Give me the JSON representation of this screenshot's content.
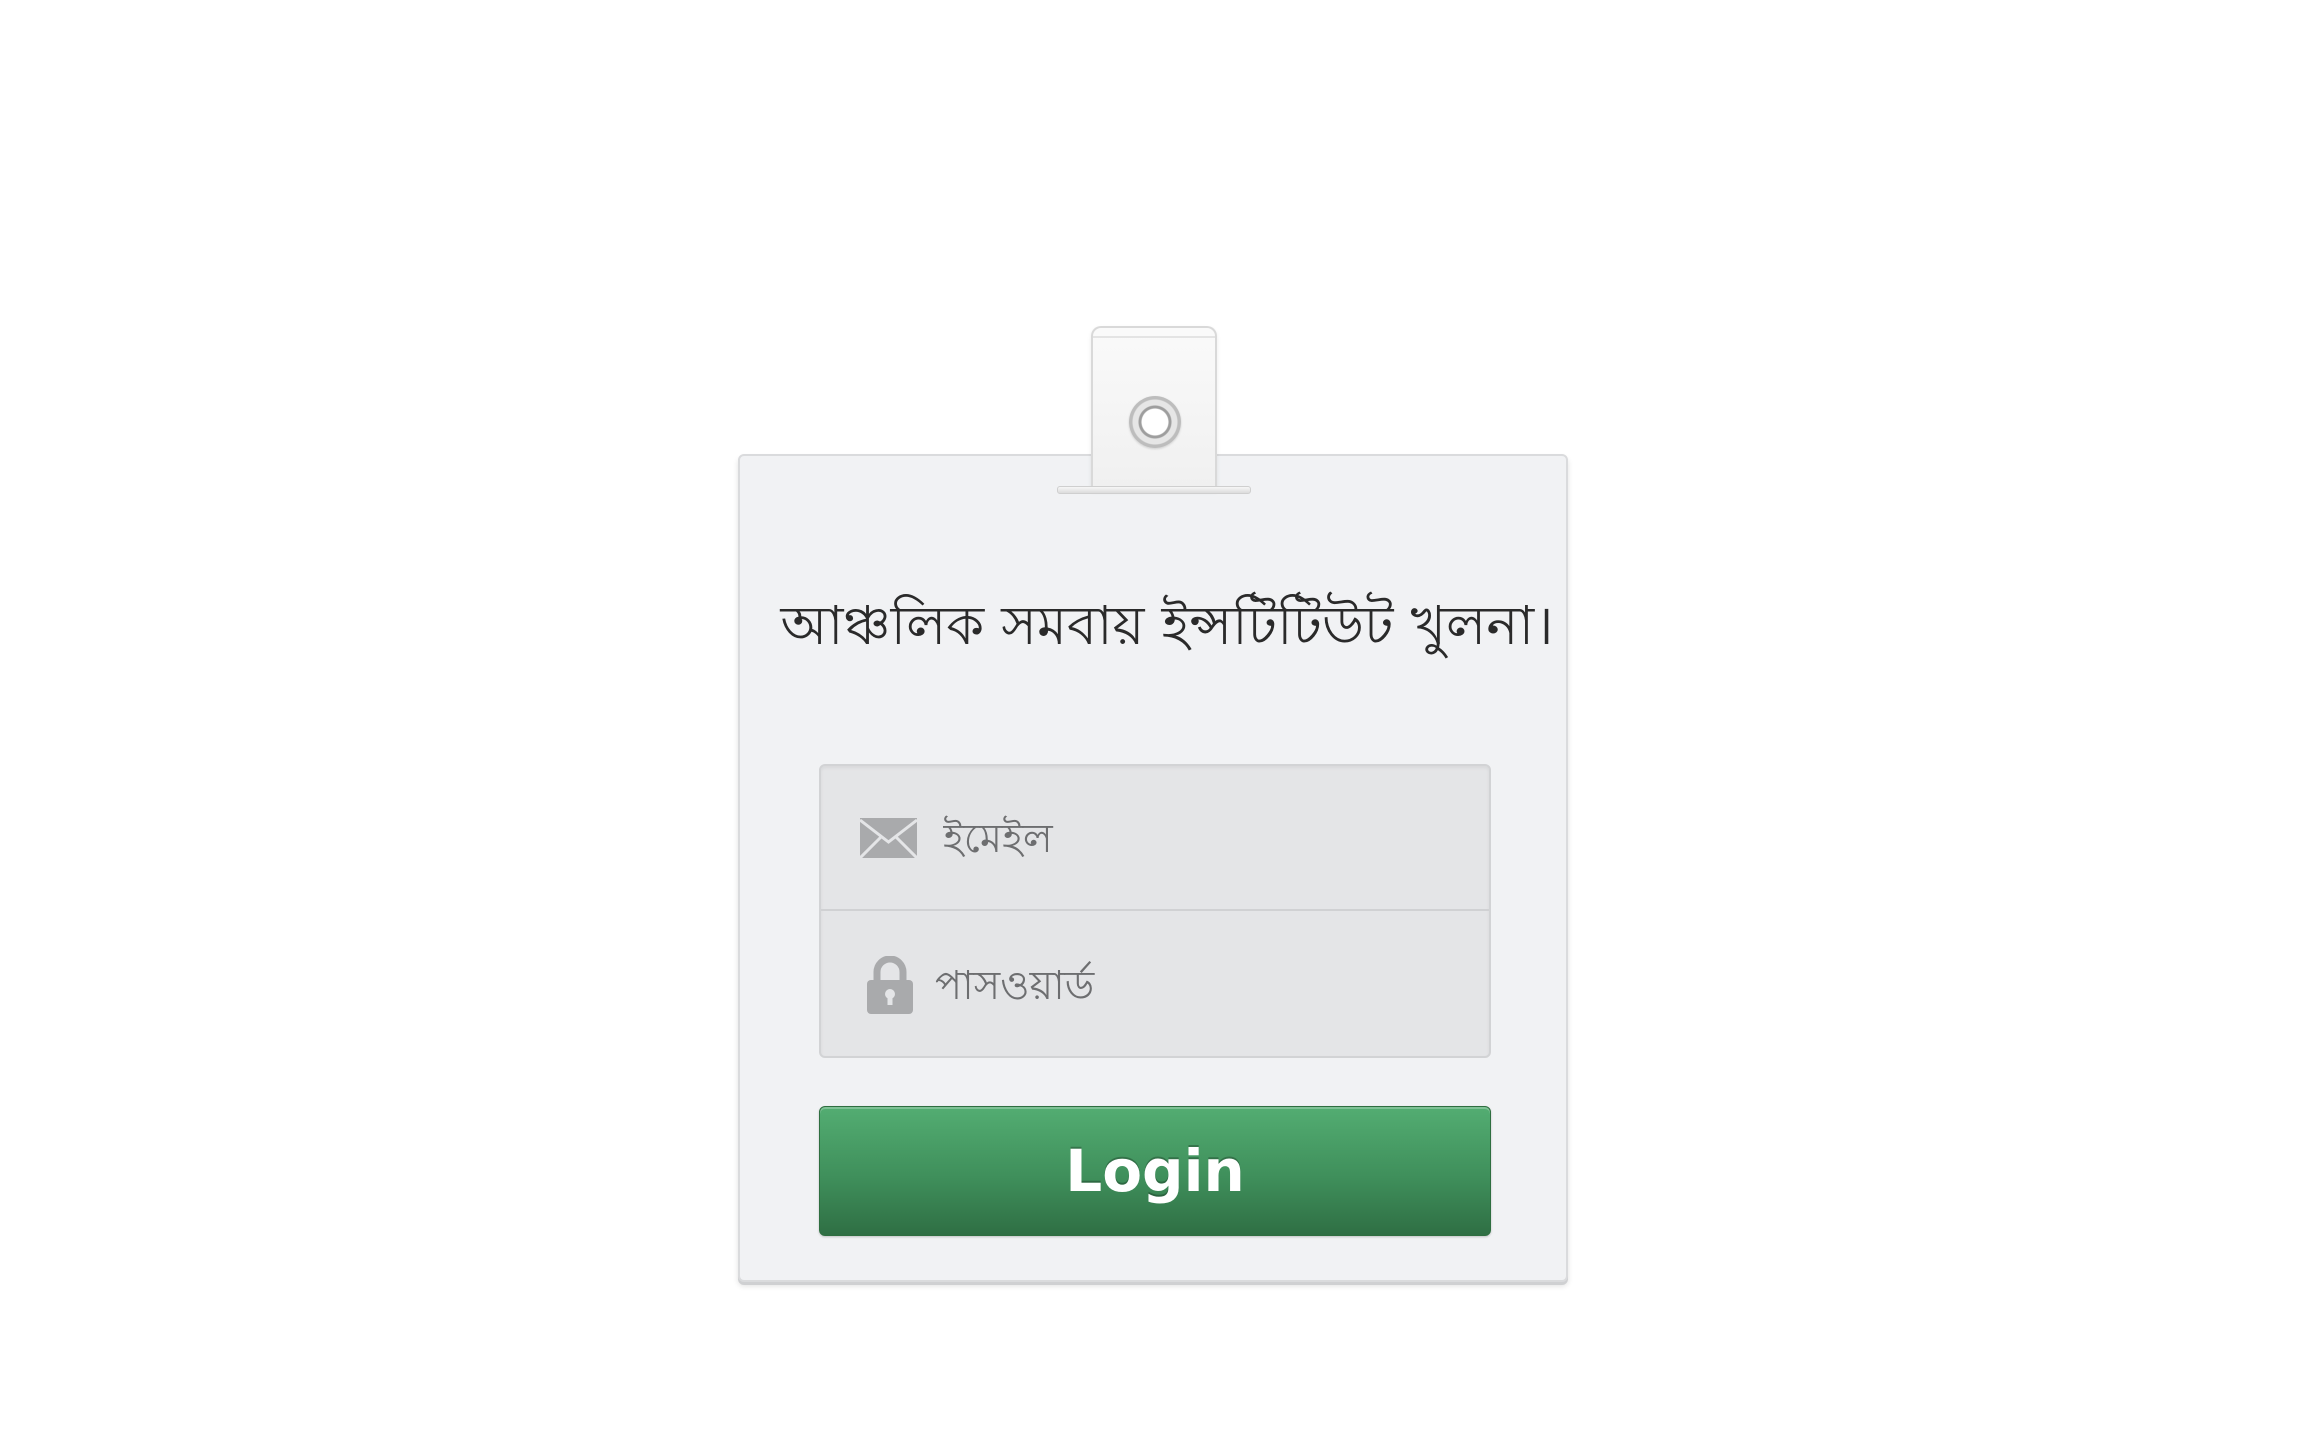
{
  "login": {
    "title": "আঞ্চলিক সমবায় ইন্সটিটিউট খুলনা।",
    "email_placeholder": "ইমেইল",
    "password_placeholder": "পাসওয়ার্ড",
    "login_label": "Login"
  },
  "icons": {
    "email": "envelope-icon",
    "password": "lock-icon"
  },
  "colors": {
    "card_background": "#f1f2f4",
    "button_green": "#3f8f5b",
    "field_background": "#e4e5e7"
  }
}
